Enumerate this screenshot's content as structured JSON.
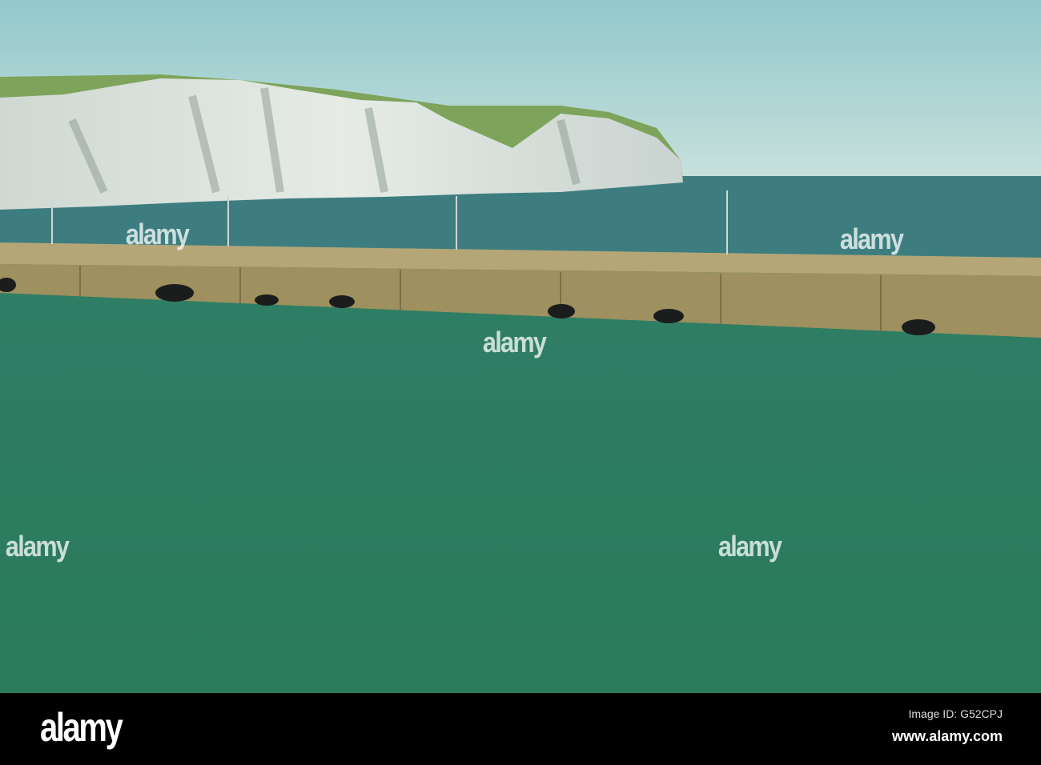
{
  "footer": {
    "logo": "alamy",
    "image_id": "Image ID: G52CPJ",
    "site": "www.alamy.com"
  },
  "watermark": "alamy",
  "colors": {
    "sky": "#a9d3d3",
    "sea_far": "#3f7e80",
    "sea_near": "#2f7c62",
    "cliff": "#d9dfda",
    "grass": "#7da35a",
    "pier": "#a99b6b"
  }
}
